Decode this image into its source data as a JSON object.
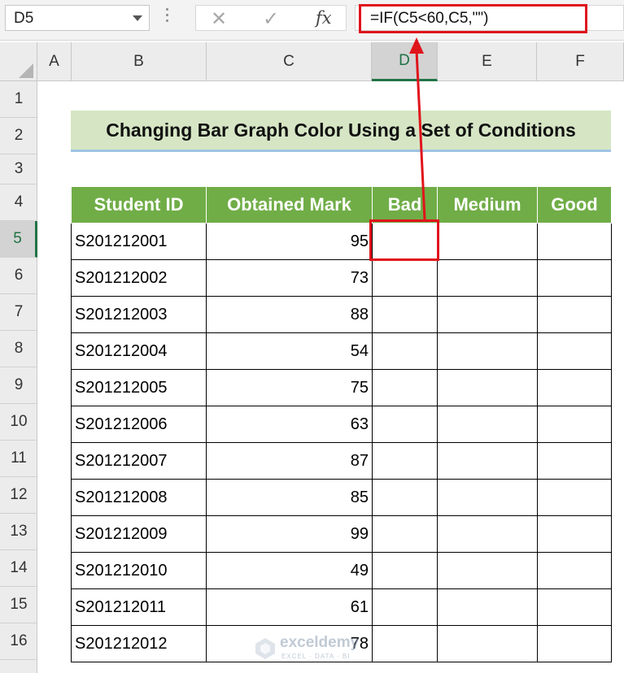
{
  "formula_bar": {
    "name_box": "D5",
    "cancel_glyph": "✕",
    "enter_glyph": "✓",
    "fx_label": "fx",
    "formula": "=IF(C5<60,C5,\"\")"
  },
  "columns": [
    "A",
    "B",
    "C",
    "D",
    "E",
    "F"
  ],
  "active_column": "D",
  "rows": [
    "1",
    "2",
    "3",
    "4",
    "5",
    "6",
    "7",
    "8",
    "9",
    "10",
    "11",
    "12",
    "13",
    "14",
    "15",
    "16"
  ],
  "active_row": "5",
  "sheet": {
    "title": "Changing Bar Graph Color Using a Set of Conditions",
    "headers": [
      "Student ID",
      "Obtained Mark",
      "Bad",
      "Medium",
      "Good"
    ],
    "records": [
      {
        "id": "S201212001",
        "mark": "95"
      },
      {
        "id": "S201212002",
        "mark": "73"
      },
      {
        "id": "S201212003",
        "mark": "88"
      },
      {
        "id": "S201212004",
        "mark": "54"
      },
      {
        "id": "S201212005",
        "mark": "75"
      },
      {
        "id": "S201212006",
        "mark": "63"
      },
      {
        "id": "S201212007",
        "mark": "87"
      },
      {
        "id": "S201212008",
        "mark": "85"
      },
      {
        "id": "S201212009",
        "mark": "99"
      },
      {
        "id": "S201212010",
        "mark": "49"
      },
      {
        "id": "S201212011",
        "mark": "61"
      },
      {
        "id": "S201212012",
        "mark": "78"
      }
    ]
  },
  "watermark": {
    "name": "exceldemy",
    "tagline": "EXCEL · DATA · BI"
  },
  "colors": {
    "header_green": "#70ad47",
    "title_bg": "#d6e6c5",
    "highlight_red": "#e0141b",
    "excel_green": "#217346"
  }
}
